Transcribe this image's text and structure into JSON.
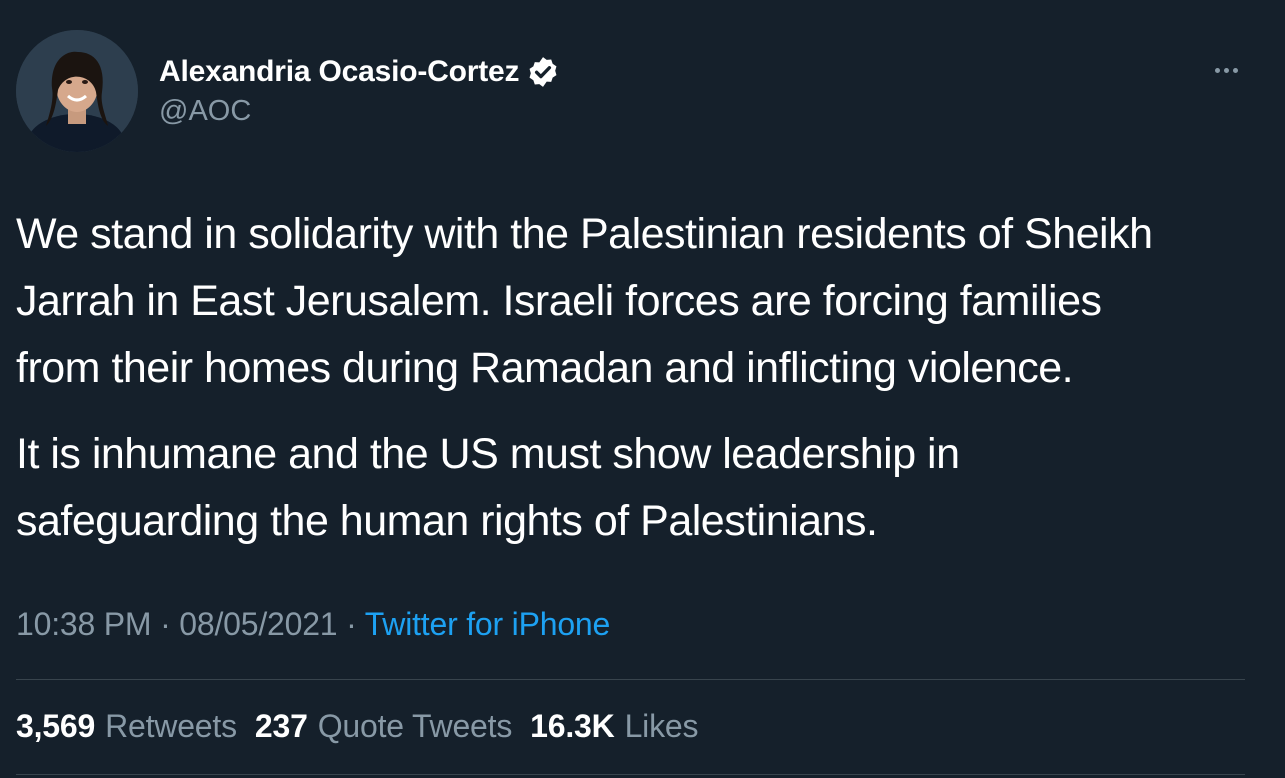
{
  "author": {
    "display_name": "Alexandria Ocasio-Cortez",
    "handle": "@AOC",
    "verified": true
  },
  "tweet": {
    "paragraphs": [
      "We stand in solidarity with the Palestinian residents of Sheikh\nJarrah in East Jerusalem. Israeli forces are forcing families\nfrom their homes during Ramadan and inflicting violence.",
      "It is inhumane and the US must show leadership in\nsafeguarding the human rights of Palestinians."
    ],
    "time": "10:38 PM",
    "separator": "·",
    "date": "08/05/2021",
    "source": "Twitter for iPhone"
  },
  "stats": {
    "retweets_count": "3,569",
    "retweets_label": "Retweets",
    "quotes_count": "237",
    "quotes_label": "Quote Tweets",
    "likes_count": "16.3K",
    "likes_label": "Likes"
  },
  "icons": {
    "verified": "verified-badge-icon",
    "more": "more-icon"
  },
  "colors": {
    "background": "#15202b",
    "text": "#ffffff",
    "secondary": "#8899a6",
    "accent": "#1da1f2",
    "divider": "#38444d"
  }
}
